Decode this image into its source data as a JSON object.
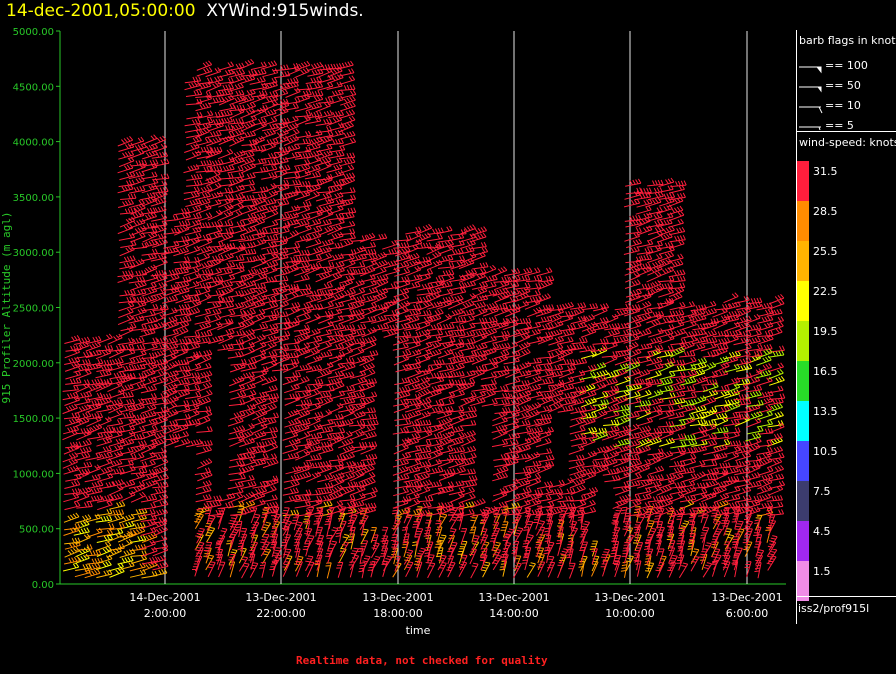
{
  "title": {
    "date": "14-dec-2001,05:00:00",
    "name": "XYWind:915winds."
  },
  "footer": "Realtime data, not checked for quality",
  "chart_data": {
    "type": "scatter",
    "ylabel": "915 Profiler Altitude (m agl)",
    "xlabel": "time",
    "ylim": [
      0,
      5000
    ],
    "yticks": [
      "0.00",
      "500.00",
      "1000.00",
      "1500.00",
      "2000.00",
      "2500.00",
      "3000.00",
      "3500.00",
      "4000.00",
      "4500.00",
      "5000.00"
    ],
    "xticks": [
      {
        "line1": "14-Dec-2001",
        "line2": "2:00:00"
      },
      {
        "line1": "13-Dec-2001",
        "line2": "22:00:00"
      },
      {
        "line1": "13-Dec-2001",
        "line2": "18:00:00"
      },
      {
        "line1": "13-Dec-2001",
        "line2": "14:00:00"
      },
      {
        "line1": "13-Dec-2001",
        "line2": "10:00:00"
      },
      {
        "line1": "13-Dec-2001",
        "line2": "6:00:00"
      }
    ],
    "grid": "vertical lines at ticks",
    "marker": "wind barbs colored by speed"
  },
  "legend": {
    "barb_header": "barb flags in knots",
    "barbs": [
      {
        "label": "== 100"
      },
      {
        "label": "== 50"
      },
      {
        "label": "== 10"
      },
      {
        "label": "== 5"
      }
    ],
    "speed_header": "wind-speed: knots",
    "colorbar": [
      {
        "value": "31.5",
        "color": "#ff1e3c"
      },
      {
        "value": "28.5",
        "color": "#ff8c00"
      },
      {
        "value": "25.5",
        "color": "#ffb400"
      },
      {
        "value": "22.5",
        "color": "#ffff00"
      },
      {
        "value": "19.5",
        "color": "#b4f000"
      },
      {
        "value": "16.5",
        "color": "#28dc28"
      },
      {
        "value": "13.5",
        "color": "#00ffff"
      },
      {
        "value": "10.5",
        "color": "#4646ff"
      },
      {
        "value": "7.5",
        "color": "#3c3c6e"
      },
      {
        "value": "4.5",
        "color": "#a028f0"
      },
      {
        "value": "1.5",
        "color": "#f08ce6"
      }
    ],
    "source": "iss2/prof915l"
  },
  "colors": {
    "axis": "#28c828",
    "grid": "#ffffff",
    "text": "#ffffff"
  }
}
